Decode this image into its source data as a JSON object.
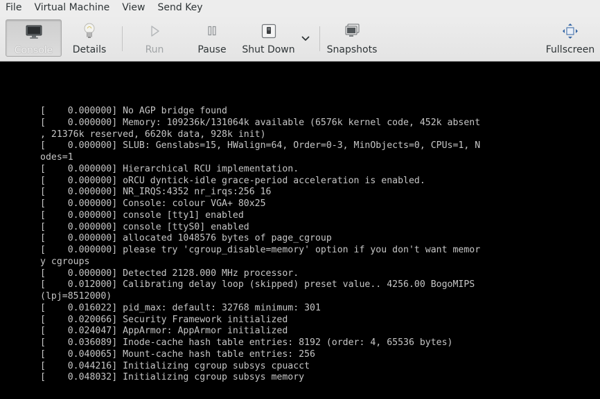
{
  "menu": {
    "items": [
      "File",
      "Virtual Machine",
      "View",
      "Send Key"
    ]
  },
  "toolbar": {
    "console_label": "Console",
    "details_label": "Details",
    "run_label": "Run",
    "pause_label": "Pause",
    "shutdown_label": "Shut Down",
    "snapshots_label": "Snapshots",
    "fullscreen_label": "Fullscreen"
  },
  "console": {
    "lines": [
      "[    0.000000] No AGP bridge found",
      "[    0.000000] Memory: 109236k/131064k available (6576k kernel code, 452k absent",
      ", 21376k reserved, 6620k data, 928k init)",
      "[    0.000000] SLUB: Genslabs=15, HWalign=64, Order=0-3, MinObjects=0, CPUs=1, N",
      "odes=1",
      "[    0.000000] Hierarchical RCU implementation.",
      "[    0.000000] oRCU dyntick-idle grace-period acceleration is enabled.",
      "[    0.000000] NR_IRQS:4352 nr_irqs:256 16",
      "[    0.000000] Console: colour VGA+ 80x25",
      "[    0.000000] console [tty1] enabled",
      "[    0.000000] console [ttyS0] enabled",
      "[    0.000000] allocated 1048576 bytes of page_cgroup",
      "[    0.000000] please try 'cgroup_disable=memory' option if you don't want memor",
      "y cgroups",
      "[    0.000000] Detected 2128.000 MHz processor.",
      "[    0.012000] Calibrating delay loop (skipped) preset value.. 4256.00 BogoMIPS",
      "(lpj=8512000)",
      "[    0.016022] pid_max: default: 32768 minimum: 301",
      "[    0.020066] Security Framework initialized",
      "[    0.024047] AppArmor: AppArmor initialized",
      "[    0.036089] Inode-cache hash table entries: 8192 (order: 4, 65536 bytes)",
      "[    0.040065] Mount-cache hash table entries: 256",
      "[    0.044216] Initializing cgroup subsys cpuacct",
      "[    0.048032] Initializing cgroup subsys memory"
    ]
  }
}
